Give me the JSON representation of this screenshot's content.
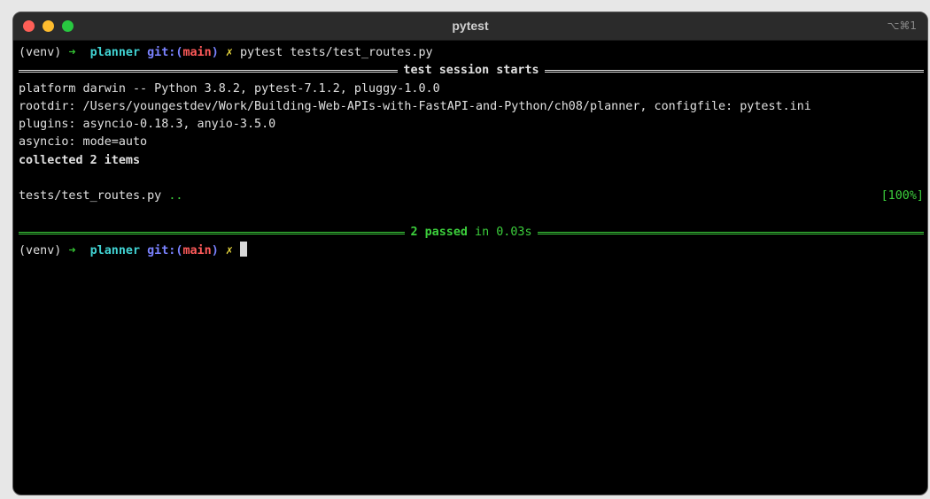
{
  "window": {
    "title": "pytest",
    "shortcut": "⌥⌘1"
  },
  "prompt": {
    "env": "(venv)",
    "arrow": "➜",
    "dir": "planner",
    "git_prefix": "git:(",
    "branch": "main",
    "git_suffix": ")",
    "dirty": "✗"
  },
  "command": "pytest tests/test_routes.py",
  "session_header": "test session starts",
  "info_lines": [
    "platform darwin -- Python 3.8.2, pytest-7.1.2, pluggy-1.0.0",
    "rootdir: /Users/youngestdev/Work/Building-Web-APIs-with-FastAPI-and-Python/ch08/planner, configfile: pytest.ini",
    "plugins: asyncio-0.18.3, anyio-3.5.0",
    "asyncio: mode=auto"
  ],
  "collected": "collected 2 items",
  "test_file": "tests/test_routes.py",
  "test_dots": "..",
  "percent": "[100%]",
  "summary": {
    "passed": "2 passed",
    "time": "in 0.03s"
  },
  "colors": {
    "accent_green": "#3ccf3c",
    "cyan": "#41d3d3",
    "blue": "#7a82ff",
    "red": "#ff5a5a",
    "yellow": "#e5d53d"
  }
}
